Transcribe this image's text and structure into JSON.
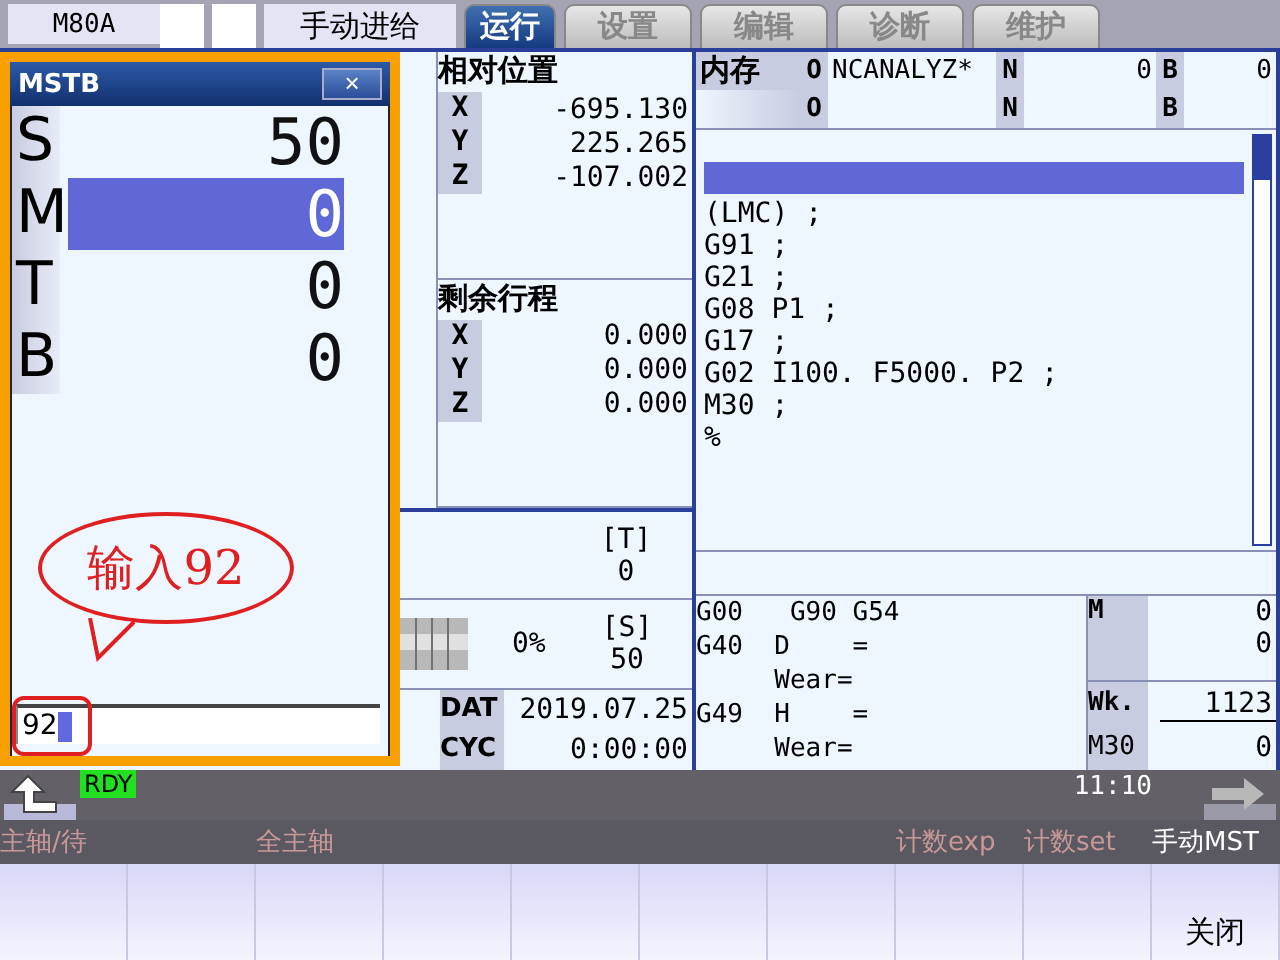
{
  "top_bar": {
    "model": "M80A",
    "mode": "手动进给",
    "tabs": [
      {
        "label": "运行",
        "selected": true
      },
      {
        "label": "设置",
        "selected": false
      },
      {
        "label": "编辑",
        "selected": false
      },
      {
        "label": "诊断",
        "selected": false
      },
      {
        "label": "维护",
        "selected": false
      }
    ]
  },
  "mstb": {
    "title": "MSTB",
    "close": "×",
    "rows": [
      {
        "label": "S",
        "value": "50",
        "selected": false
      },
      {
        "label": "M",
        "value": "0",
        "selected": true
      },
      {
        "label": "T",
        "value": "0",
        "selected": false
      },
      {
        "label": "B",
        "value": "0",
        "selected": false
      }
    ],
    "input": {
      "value": "92"
    }
  },
  "annotation": {
    "text": "输入92"
  },
  "relative_position": {
    "title": "相对位置",
    "axes": [
      {
        "axis": "X",
        "value": "-695.130"
      },
      {
        "axis": "Y",
        "value": "225.265"
      },
      {
        "axis": "Z",
        "value": "-107.002"
      }
    ]
  },
  "remaining_travel": {
    "title": "剩余行程",
    "axes": [
      {
        "axis": "X",
        "value": "0.000"
      },
      {
        "axis": "Y",
        "value": "0.000"
      },
      {
        "axis": "Z",
        "value": "0.000"
      }
    ]
  },
  "tool": {
    "label": "[T]",
    "value": "0"
  },
  "spindle": {
    "percent": "0%",
    "label": "[S]",
    "value": "50"
  },
  "clock_info": [
    {
      "label": "DAT",
      "value": "2019.07.25"
    },
    {
      "label": "CYC",
      "value": "0:00:00"
    }
  ],
  "program_header": {
    "source": "内存",
    "rows": [
      [
        {
          "label": "O",
          "value": "NCANALYZ*"
        },
        {
          "label": "N",
          "value": "0"
        },
        {
          "label": "B",
          "value": "0"
        }
      ],
      [
        {
          "label": "O"
        },
        {
          "label": "N"
        },
        {
          "label": "B"
        }
      ]
    ]
  },
  "program_lines": [
    {
      "selected": true
    },
    {
      "text": "(LMC) ;",
      "selected": false
    },
    {
      "text": "G91 ;",
      "selected": false
    },
    {
      "text": "G21 ;",
      "selected": false
    },
    {
      "text": "G08 P1 ;",
      "selected": false
    },
    {
      "text": "G17 ;",
      "selected": false
    },
    {
      "text": "G02 I100. F5000. P2 ;",
      "selected": false
    },
    {
      "text": "M30 ;",
      "selected": false
    },
    {
      "text": "%",
      "selected": false
    }
  ],
  "modal_lines": [
    "G00   G90 G54",
    "G40  D    =",
    "     Wear=",
    "G49  H    =",
    "     Wear="
  ],
  "counters": {
    "m_label": "M",
    "m_values": [
      "0",
      "0"
    ],
    "wk_label": "Wk.",
    "wk_value": "1123",
    "m30_label": "M30",
    "m30_value": "0"
  },
  "status_bar": {
    "state": "RDY",
    "time": "11:10"
  },
  "softkeys": [
    {
      "kind": "captioned",
      "caption": "主轴/待",
      "disabled": true
    },
    {
      "kind": "blank"
    },
    {
      "kind": "captioned",
      "caption": "全主轴",
      "disabled": true
    },
    {
      "kind": "blank"
    },
    {
      "kind": "blank"
    },
    {
      "kind": "blank"
    },
    {
      "kind": "blank"
    },
    {
      "kind": "captioned",
      "caption": "计数exp",
      "disabled": true
    },
    {
      "kind": "captioned",
      "caption": "计数set",
      "disabled": true
    },
    {
      "kind": "captioned",
      "caption": "手动MST",
      "disabled": false,
      "label": "关闭"
    }
  ]
}
